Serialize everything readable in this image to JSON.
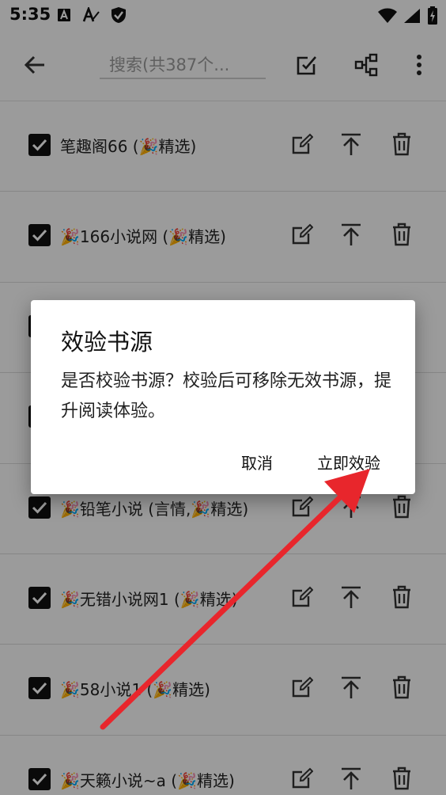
{
  "status_bar": {
    "time": "5:35",
    "left_icons": [
      "a-icon",
      "a-slash-icon",
      "shield-check-icon"
    ],
    "right_icons": [
      "wifi-icon",
      "signal-icon",
      "battery-icon"
    ]
  },
  "toolbar": {
    "search_placeholder": "搜索(共387个...",
    "icons": [
      "back-arrow-icon",
      "select-edit-icon",
      "group-icon",
      "more-vert-icon"
    ]
  },
  "sources": [
    {
      "label": "笔趣阁66 (🎉精选)",
      "checked": true
    },
    {
      "label": "🎉166小说网 (🎉精选)",
      "checked": true
    },
    {
      "label": "",
      "checked": true
    },
    {
      "label": "",
      "checked": true
    },
    {
      "label": "🎉铅笔小说 (言情,🎉精选)",
      "checked": true
    },
    {
      "label": "🎉无错小说网1 (🎉精选)",
      "checked": true
    },
    {
      "label": "🎉58小说1 (🎉精选)",
      "checked": true
    },
    {
      "label": "🎉天籁小说~a (🎉精选)",
      "checked": true
    }
  ],
  "dialog": {
    "title": "效验书源",
    "message": "是否校验书源？校验后可移除无效书源，提升阅读体验。",
    "cancel_label": "取消",
    "confirm_label": "立即效验"
  },
  "colors": {
    "overlay": "#000000",
    "checkbox": "#111111",
    "arrow": "#e8262c"
  }
}
